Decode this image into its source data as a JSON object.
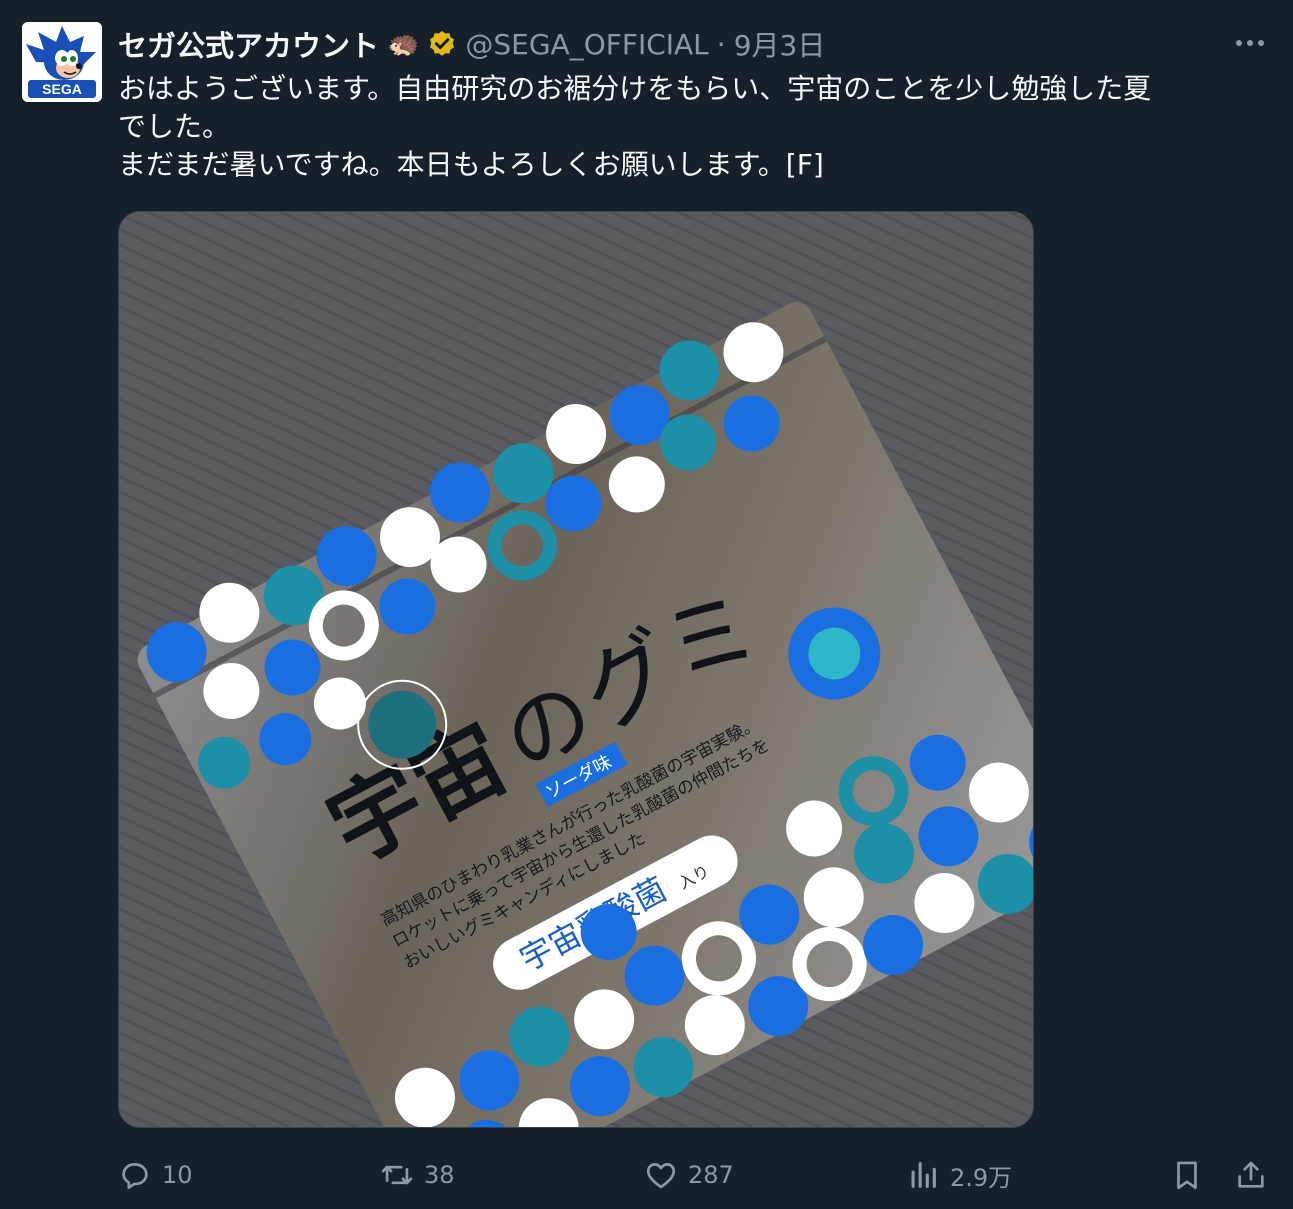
{
  "account": {
    "display_name": "セガ公式アカウント",
    "emoji": "🦔",
    "handle": "@SEGA_OFFICIAL",
    "separator": "·",
    "date": "9月3日",
    "avatar_text": "SEGA"
  },
  "post": {
    "lines": [
      "おはようございます。自由研究のお裾分けをもらい、宇宙のことを少し勉強した夏",
      "でした。",
      "まだまだ暑いですね。本日もよろしくお願いします。[F]"
    ]
  },
  "media": {
    "package": {
      "title_kanji": "宇宙",
      "title_no": "の",
      "title_gumi": "グミ",
      "flavor": "ソーダ味",
      "desc_lines": [
        "高知県のひまわり乳業さんが行った乳酸菌の宇宙実験。",
        "ロケットに乗って宇宙から生還した乳酸菌の仲間たちを",
        "おいしいグミキャンディにしました"
      ],
      "badge": "宇宙乳酸菌",
      "badge_suffix": "入り"
    }
  },
  "actions": {
    "reply_count": "10",
    "repost_count": "38",
    "like_count": "287",
    "view_count": "2.9万"
  },
  "colors": {
    "background": "#15202b",
    "text": "#f7f9f9",
    "secondary": "#8b98a5",
    "verified": "#e2b719",
    "dot_blue": "#1a6ee0",
    "dot_teal": "#1d8fa6"
  }
}
